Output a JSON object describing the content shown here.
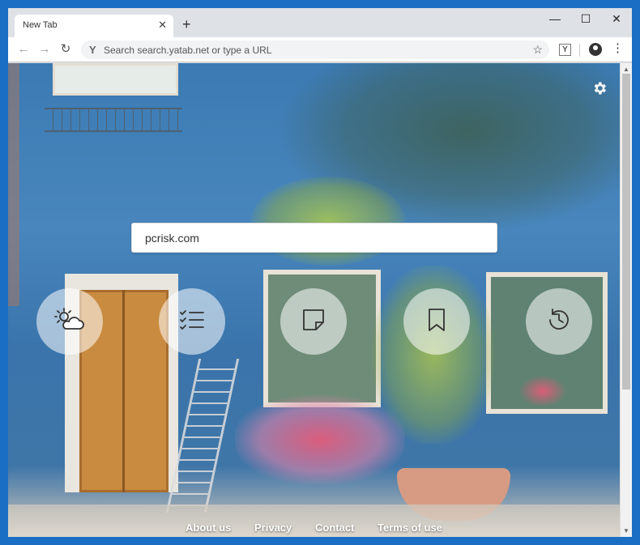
{
  "tab": {
    "title": "New Tab",
    "close": "✕",
    "new_tab": "+"
  },
  "window_controls": {
    "minimize": "—",
    "maximize": "☐",
    "close": "✕"
  },
  "toolbar": {
    "back": "←",
    "forward": "→",
    "reload": "↻",
    "omnibox_icon": "Y",
    "omnibox_placeholder": "Search search.yatab.net or type a URL",
    "star": "☆",
    "extension_label": "Y",
    "menu": "⋮"
  },
  "page": {
    "search_value": "pcrisk.com",
    "settings_icon": "gear-icon",
    "quick_buttons": [
      {
        "name": "weather",
        "icon": "weather-icon"
      },
      {
        "name": "todo",
        "icon": "checklist-icon"
      },
      {
        "name": "notes",
        "icon": "note-icon"
      },
      {
        "name": "bookmarks",
        "icon": "bookmark-icon"
      },
      {
        "name": "history",
        "icon": "history-icon"
      }
    ],
    "footer": {
      "about": "About us",
      "privacy": "Privacy",
      "contact": "Contact",
      "terms": "Terms of use"
    }
  },
  "colors": {
    "frame": "#1a6fc4",
    "tab_strip": "#dee1e6",
    "button_bg": "#ffffff"
  }
}
